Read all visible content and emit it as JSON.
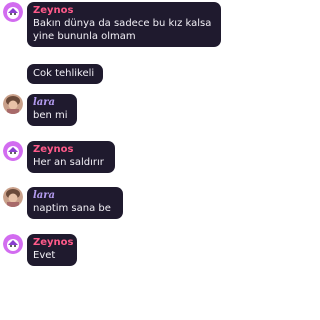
{
  "messages": [
    {
      "author": "Zeynos",
      "text": "Bakın dünya da sadece bu kız kalsa yine bununla olmam"
    },
    {
      "author": "",
      "text": "Cok tehlikeli"
    },
    {
      "author": "lara",
      "text": "ben mi"
    },
    {
      "author": "Zeynos",
      "text": "Her an saldırır"
    },
    {
      "author": "lara",
      "text": "naptim sana be"
    },
    {
      "author": "Zeynos",
      "text": "Evet"
    }
  ],
  "colors": {
    "bubble": "#1f1a2e",
    "zeynos_name": "#ff5a8a",
    "lara_name": "#b49cf0"
  }
}
